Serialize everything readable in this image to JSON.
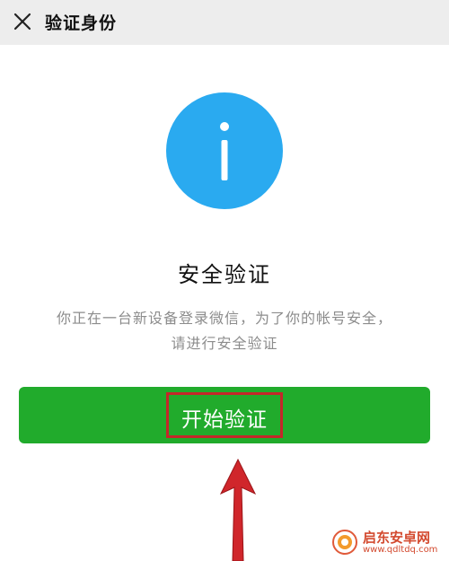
{
  "header": {
    "title": "验证身份",
    "close_icon": "close-icon"
  },
  "main": {
    "icon": "info-icon",
    "icon_color": "#2aaaf0",
    "title": "安全验证",
    "description_line1": "你正在一台新设备登录微信，为了你的帐号安全，",
    "description_line2": "请进行安全验证",
    "start_button_label": "开始验证",
    "button_color": "#21ab2c",
    "highlight_color": "#c4272a"
  },
  "watermark": {
    "name": "启东安卓网",
    "url": "www.qdltdq.com"
  }
}
